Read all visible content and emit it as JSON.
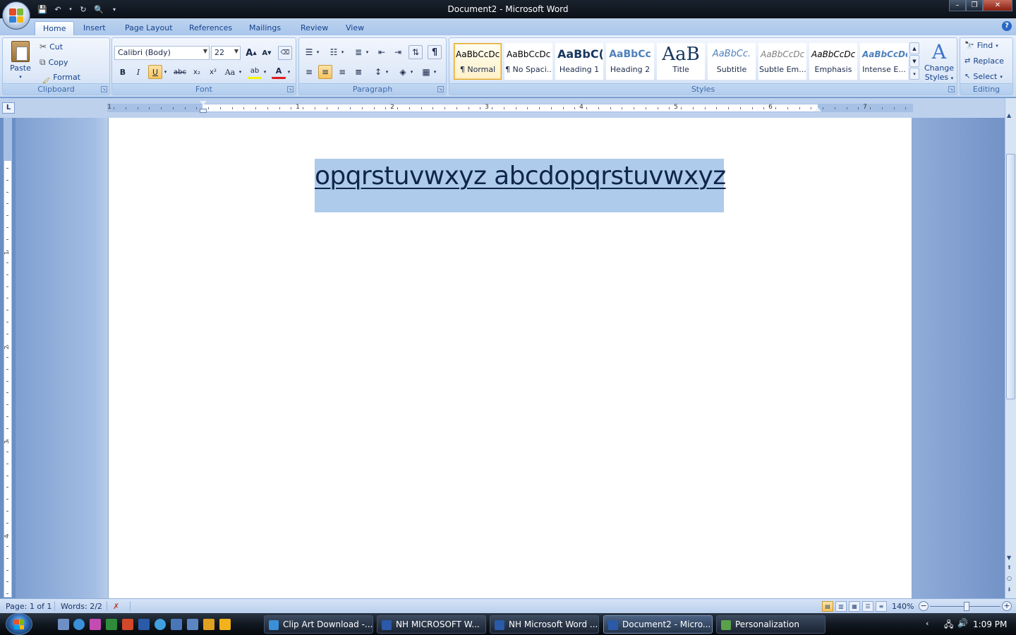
{
  "window": {
    "title": "Document2 - Microsoft Word",
    "controls": {
      "minimize": "–",
      "maximize": "❐",
      "close": "✕"
    }
  },
  "quick_access": [
    "save-icon",
    "undo-icon",
    "redo-icon",
    "print-preview-icon",
    "customize-icon"
  ],
  "tabs": [
    "Home",
    "Insert",
    "Page Layout",
    "References",
    "Mailings",
    "Review",
    "View"
  ],
  "active_tab": "Home",
  "clipboard": {
    "label": "Clipboard",
    "paste": "Paste",
    "cut": "Cut",
    "copy": "Copy",
    "format_painter": "Format Painter"
  },
  "font": {
    "label": "Font",
    "family": "Calibri (Body)",
    "size": "22",
    "bold": "B",
    "italic": "I",
    "underline": "U",
    "strike": "abc",
    "subscript": "x₂",
    "superscript": "x²",
    "change_case": "Aa",
    "grow": "A",
    "shrink": "A",
    "highlight": "ab",
    "font_color": "A"
  },
  "paragraph": {
    "label": "Paragraph",
    "pilcrow": "¶"
  },
  "styles": {
    "label": "Styles",
    "items": [
      {
        "sample": "AaBbCcDc",
        "name": "¶ Normal"
      },
      {
        "sample": "AaBbCcDc",
        "name": "¶ No Spaci..."
      },
      {
        "sample": "AaBbC(",
        "name": "Heading 1"
      },
      {
        "sample": "AaBbCc",
        "name": "Heading 2"
      },
      {
        "sample": "AaB",
        "name": "Title"
      },
      {
        "sample": "AaBbCc.",
        "name": "Subtitle"
      },
      {
        "sample": "AaBbCcDc",
        "name": "Subtle Em..."
      },
      {
        "sample": "AaBbCcDc",
        "name": "Emphasis"
      },
      {
        "sample": "AaBbCcDc",
        "name": "Intense E..."
      }
    ],
    "change_styles_line1": "Change",
    "change_styles_line2": "Styles"
  },
  "editing": {
    "label": "Editing",
    "find": "Find",
    "replace": "Replace",
    "select": "Select"
  },
  "ruler": {
    "numbers": [
      "1",
      "1",
      "2",
      "3",
      "4",
      "5",
      "6",
      "7"
    ],
    "tab_selector": "L"
  },
  "vruler_numbers": [
    "1",
    "2",
    "3",
    "4"
  ],
  "document": {
    "text": "opqrstuvwxyz abcdopqrstuvwxyz"
  },
  "status": {
    "page": "Page: 1 of 1",
    "words": "Words: 2/2",
    "zoom": "140%"
  },
  "taskbar": {
    "tasks": [
      "Clip Art Download -...",
      "NH MICROSOFT W...",
      "NH Microsoft Word ...",
      "Document2 - Micro...",
      "Personalization"
    ],
    "active_task": "Document2 - Micro...",
    "time": "1:09 PM"
  },
  "colors": {
    "accent": "#15428b",
    "selection": "#aecbeb",
    "text": "#10254a"
  }
}
